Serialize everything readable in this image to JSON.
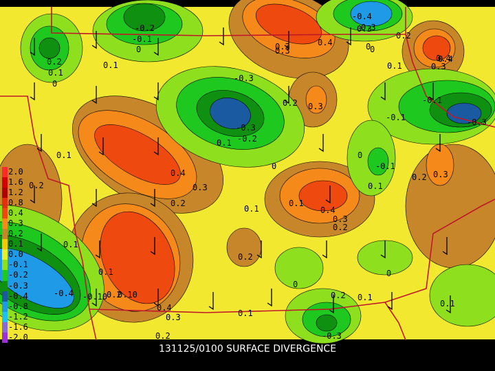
{
  "caption": "131125/0100 SURFACE DIVERGENCE",
  "legend": [
    {
      "label": "2.0",
      "color": "#ff2a2a"
    },
    {
      "label": "1.6",
      "color": "#d40000"
    },
    {
      "label": "1.2",
      "color": "#b00000"
    },
    {
      "label": "0.8",
      "color": "#e03010"
    },
    {
      "label": "0.4",
      "color": "#ee4a10"
    },
    {
      "label": "0.3",
      "color": "#f58a1a"
    },
    {
      "label": "0.2",
      "color": "#c8862a"
    },
    {
      "label": "0.1",
      "color": "#f5c800"
    },
    {
      "label": "0.0",
      "color": "#e6ef2a"
    },
    {
      "label": "-0.1",
      "color": "#8ee01e"
    },
    {
      "label": "-0.2",
      "color": "#1ec81e"
    },
    {
      "label": "-0.3",
      "color": "#109010"
    },
    {
      "label": "-0.4",
      "color": "#1a5aa0"
    },
    {
      "label": "-0.8",
      "color": "#1e9ae6"
    },
    {
      "label": "-1.2",
      "color": "#20c0f0"
    },
    {
      "label": "-1.6",
      "color": "#8a6ad8"
    },
    {
      "label": "-2.0",
      "color": "#9b30d8"
    }
  ],
  "contour_labels": [
    "-0.2",
    "-0.1",
    "0",
    "0.2",
    "0.1",
    "0",
    "0.1",
    "0.4",
    "0.3",
    "0.4",
    "0.3",
    "0.2",
    "0.3",
    "0",
    "0.1",
    "0.2",
    "0.3",
    "-0.3",
    "0.1",
    "-0.2",
    "0.1",
    "0.4",
    "0.3",
    "0.2",
    "0.1",
    "0.4",
    "0.3",
    "0.2",
    "-0.1",
    "0",
    "-0.1",
    "0.1",
    "-0.3",
    "0.2",
    "0.3",
    "0.1",
    "0.2",
    "0.1",
    "0",
    "0",
    "0.2",
    "0.1",
    "-0.4",
    "-0.10",
    "0.2",
    "0.10",
    "0.4",
    "0.3",
    "0.2",
    "0.1",
    "0.2",
    "0.1",
    "-0.3",
    "0",
    "0.3",
    "-0.4",
    "0.3",
    "0.4",
    "0",
    "-0.1",
    "-0.3",
    "0.1"
  ],
  "colors": {
    "base": "#f2e830",
    "yellow": "#f5c800",
    "brown": "#c8862a",
    "orange": "#f58a1a",
    "red": "#ee4a10",
    "lime": "#8ee01e",
    "green": "#1ec81e",
    "dkgreen": "#109010",
    "blue": "#1a5aa0",
    "lightblue": "#1e9ae6",
    "border": "#c0182a"
  }
}
